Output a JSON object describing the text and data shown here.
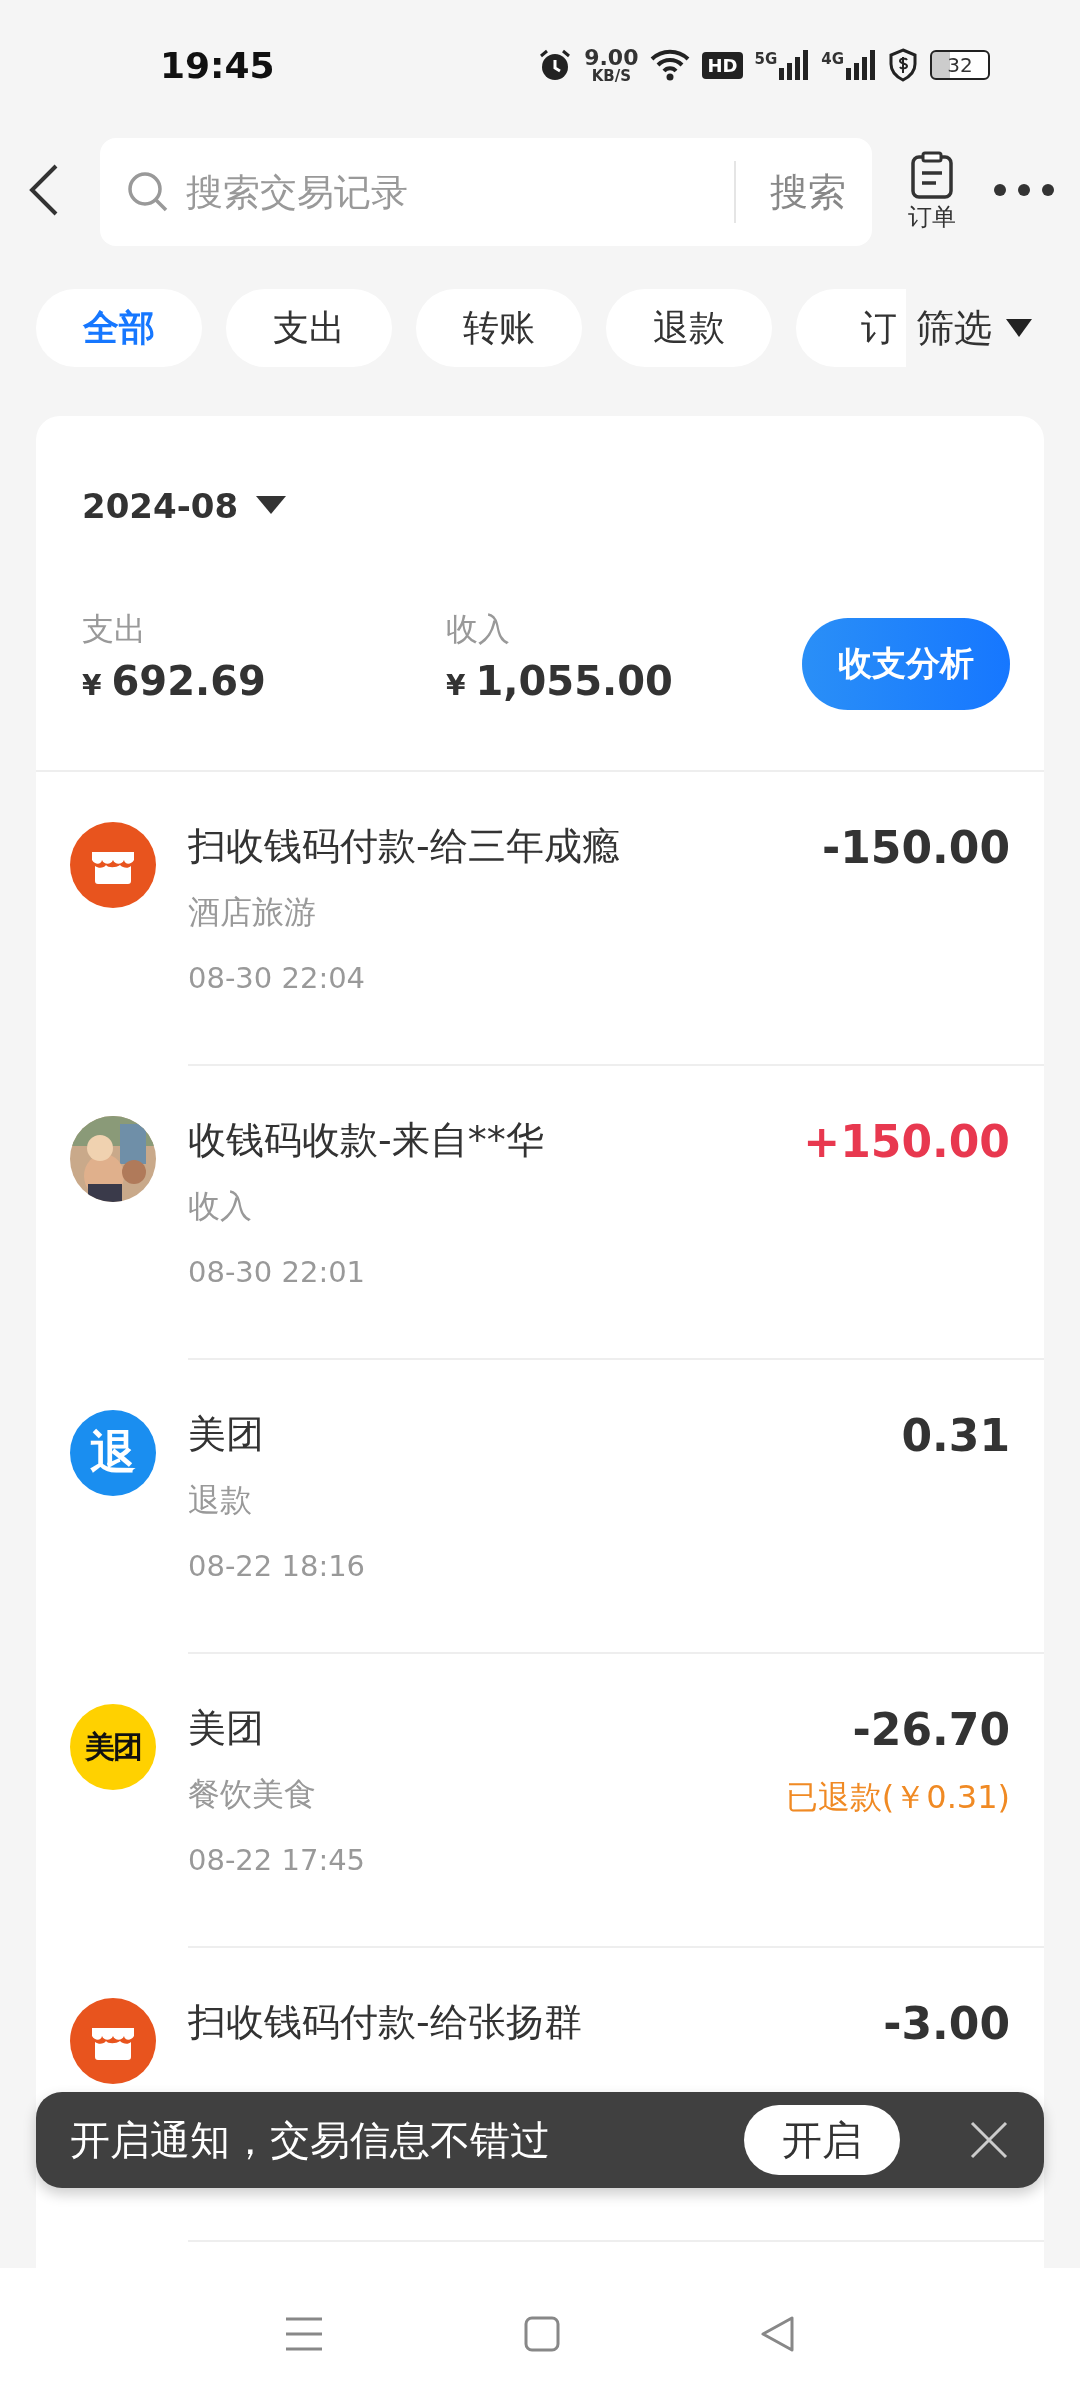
{
  "status_bar": {
    "time": "19:45",
    "speed": "9.00",
    "speed_unit": "KB/S",
    "hd": "HD",
    "networks": [
      "5G",
      "4G"
    ],
    "battery": "32"
  },
  "top_bar": {
    "search_placeholder": "搜索交易记录",
    "search_button": "搜索",
    "orders_label": "订单"
  },
  "filters": [
    {
      "label": "全部",
      "selected": true
    },
    {
      "label": "支出",
      "selected": false
    },
    {
      "label": "转账",
      "selected": false
    },
    {
      "label": "退款",
      "selected": false
    },
    {
      "label": "订",
      "selected": false
    }
  ],
  "filter_button": "筛选",
  "summary": {
    "month": "2024-08",
    "expense_label": "支出",
    "expense_currency": "¥",
    "expense": "692.69",
    "income_label": "收入",
    "income_currency": "¥",
    "income": "1,055.00",
    "analysis_button": "收支分析"
  },
  "transactions": [
    {
      "icon": {
        "kind": "shop"
      },
      "title": "扫收钱码付款-给三年成瘾",
      "category": "酒店旅游",
      "date": "08-30 22:04",
      "amount": {
        "text": "-150.00",
        "color": "#333333"
      }
    },
    {
      "title": "收钱码收款-来自**华",
      "category": "收入",
      "date": "08-30 22:01",
      "amount": {
        "text": "+150.00",
        "color": "#e8384f"
      }
    },
    {
      "icon": {
        "kind": "badge",
        "text": "退"
      },
      "title": "美团",
      "category": "退款",
      "date": "08-22 18:16",
      "amount": {
        "text": "0.31",
        "color": "#333333"
      }
    },
    {
      "icon": {
        "kind": "brand",
        "text": "美团"
      },
      "title": "美团",
      "category": "餐饮美食",
      "date": "08-22 17:45",
      "amount": {
        "text": "-26.70",
        "color": "#333333"
      },
      "note": "已退款(￥0.31)"
    },
    {
      "icon": {
        "kind": "shop"
      },
      "title": "扫收钱码付款-给张扬群",
      "amount": {
        "text": "-3.00",
        "color": "#333333"
      }
    }
  ],
  "toast": {
    "message": "开启通知，交易信息不错过",
    "button": "开启"
  }
}
